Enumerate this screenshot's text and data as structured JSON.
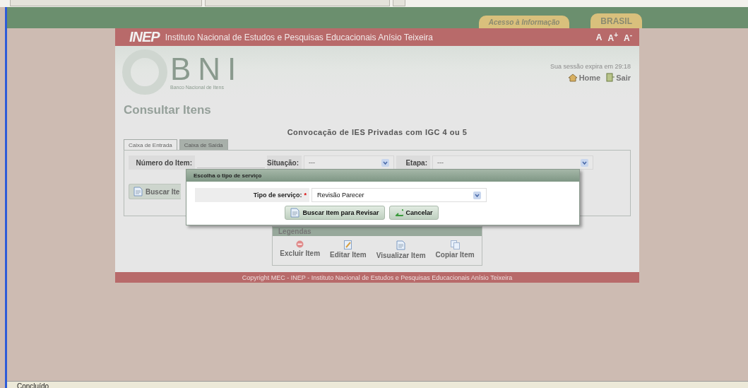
{
  "browser": {
    "status": "Concluído"
  },
  "gov_bar": {
    "links": [
      "Acesso à Informação",
      "BRASIL"
    ]
  },
  "header": {
    "logo": "INEP",
    "title": "Instituto Nacional de Estudos e Pesquisas Educacionais Anísio Teixeira",
    "font_controls": [
      "A",
      "A$^{+}$",
      "A$^{-}$"
    ]
  },
  "banner": {
    "logo": "BNI",
    "subtitle": "Banco Nacional de Itens",
    "session": "Sua sessão expira em 29:18",
    "links": [
      {
        "label": "Home",
        "kind": "home"
      },
      {
        "label": "Sair",
        "kind": "exit"
      }
    ]
  },
  "page_title": "Consultar Itens",
  "subtitle": "Convocação de IES Privadas com IGC 4 ou 5",
  "tabs": [
    {
      "label": "Caixa de Entrada",
      "selected": true
    },
    {
      "label": "Caixa de Saída",
      "selected": false
    }
  ],
  "filters": [
    {
      "label": "Número do Item:",
      "kind": "text"
    },
    {
      "label": "Situação:",
      "kind": "select",
      "value": "---"
    },
    {
      "label": "Etapa:",
      "kind": "select",
      "value": "---"
    }
  ],
  "search_button": "Buscar Ite",
  "legend": {
    "title": "Legendas",
    "items": [
      {
        "label": "Excluir Item",
        "kind": "delete"
      },
      {
        "label": "Editar Item",
        "kind": "edit"
      },
      {
        "label": "Visualizar Item",
        "kind": "view"
      },
      {
        "label": "Copiar Item",
        "kind": "copy"
      }
    ]
  },
  "footer": "Copyright MEC - INEP - Instituto Nacional de Estudos e Pesquisas Educacionais Anísio Teixeira",
  "dialog": {
    "title": "Escolha o tipo de serviço",
    "field": {
      "label": "Tipo de serviço:",
      "required_mark": "*",
      "value": "Revisão Parecer"
    },
    "buttons": [
      {
        "label": "Buscar Item para Revisar",
        "kind": "search"
      },
      {
        "label": "Cancelar",
        "kind": "cancel"
      }
    ]
  }
}
